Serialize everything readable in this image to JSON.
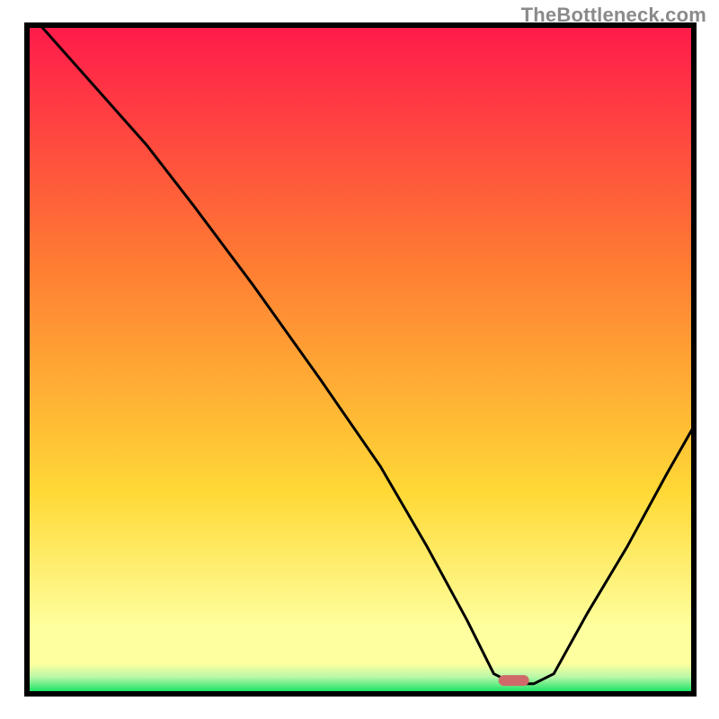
{
  "watermark": "TheBottleneck.com",
  "chart_data": {
    "type": "line",
    "title": "",
    "xlabel": "",
    "ylabel": "",
    "xlim": [
      0,
      100
    ],
    "ylim": [
      0,
      100
    ],
    "axes_visible": false,
    "grid": false,
    "background_gradient": {
      "top_color": "#ff1a4b",
      "mid1_color": "#ff7a33",
      "mid2_color": "#ffd936",
      "band_color": "#feff9e",
      "bottom_color": "#00e05a"
    },
    "marker": {
      "x": 73,
      "y": 2,
      "color": "#d06a6a",
      "shape": "rounded-bar"
    },
    "series": [
      {
        "name": "curve",
        "points": [
          {
            "x": 2,
            "y": 100
          },
          {
            "x": 18,
            "y": 82
          },
          {
            "x": 25,
            "y": 73
          },
          {
            "x": 34,
            "y": 61
          },
          {
            "x": 44,
            "y": 47
          },
          {
            "x": 53,
            "y": 34
          },
          {
            "x": 60,
            "y": 22
          },
          {
            "x": 66,
            "y": 11
          },
          {
            "x": 70,
            "y": 3
          },
          {
            "x": 73,
            "y": 1.5
          },
          {
            "x": 76,
            "y": 1.5
          },
          {
            "x": 79,
            "y": 3
          },
          {
            "x": 84,
            "y": 12
          },
          {
            "x": 90,
            "y": 22
          },
          {
            "x": 96,
            "y": 33
          },
          {
            "x": 100,
            "y": 40
          }
        ]
      }
    ]
  }
}
